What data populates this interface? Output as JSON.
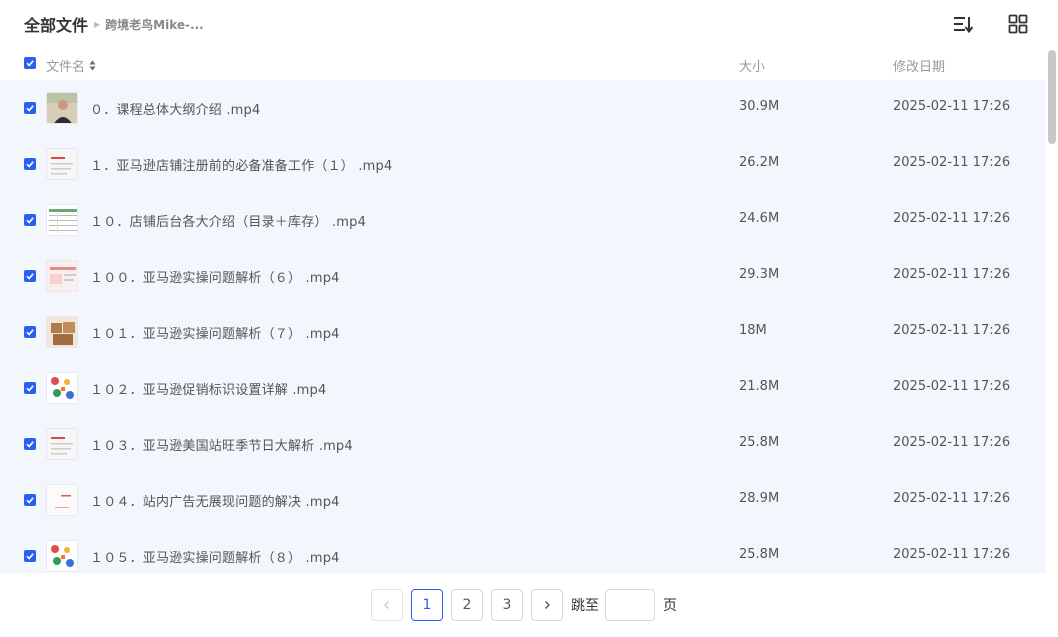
{
  "breadcrumb": {
    "root": "全部文件",
    "current": "跨境老鸟Mike-..."
  },
  "toolbar": {
    "sort_icon": "sort-list-icon",
    "view_icon": "grid-view-icon"
  },
  "table": {
    "columns": {
      "name": "文件名",
      "size": "大小",
      "modified": "修改日期"
    },
    "all_selected": true,
    "rows": [
      {
        "name": "０．课程总体大纲介绍 .mp4",
        "size": "30.9M",
        "date": "2025-02-11 17:26",
        "thumb": "person"
      },
      {
        "name": "１．亚马逊店铺注册前的必备准备工作（１） .mp4",
        "size": "26.2M",
        "date": "2025-02-11 17:26",
        "thumb": "slide-red"
      },
      {
        "name": "１０．店铺后台各大介绍（目录＋库存） .mp4",
        "size": "24.6M",
        "date": "2025-02-11 17:26",
        "thumb": "table"
      },
      {
        "name": "１００．亚马逊实操问题解析（６） .mp4",
        "size": "29.3M",
        "date": "2025-02-11 17:26",
        "thumb": "slide-pink"
      },
      {
        "name": "１０１．亚马逊实操问题解析（７） .mp4",
        "size": "18M",
        "date": "2025-02-11 17:26",
        "thumb": "boxes"
      },
      {
        "name": "１０２．亚马逊促销标识设置详解 .mp4",
        "size": "21.8M",
        "date": "2025-02-11 17:26",
        "thumb": "colorful"
      },
      {
        "name": "１０３．亚马逊美国站旺季节日大解析 .mp4",
        "size": "25.8M",
        "date": "2025-02-11 17:26",
        "thumb": "slide-red"
      },
      {
        "name": "１０４．站内广告无展现问题的解决 .mp4",
        "size": "28.9M",
        "date": "2025-02-11 17:26",
        "thumb": "blank-red"
      },
      {
        "name": "１０５．亚马逊实操问题解析（８） .mp4",
        "size": "25.8M",
        "date": "2025-02-11 17:26",
        "thumb": "colorful"
      }
    ]
  },
  "pagination": {
    "prev_icon": "chevron-left-icon",
    "next_icon": "chevron-right-icon",
    "pages": [
      "1",
      "2",
      "3"
    ],
    "current": "1",
    "jump_label": "跳至",
    "jump_value": "",
    "page_unit": "页"
  },
  "colors": {
    "accent": "#2b5ff0",
    "row_bg": "#f4f6fd"
  }
}
